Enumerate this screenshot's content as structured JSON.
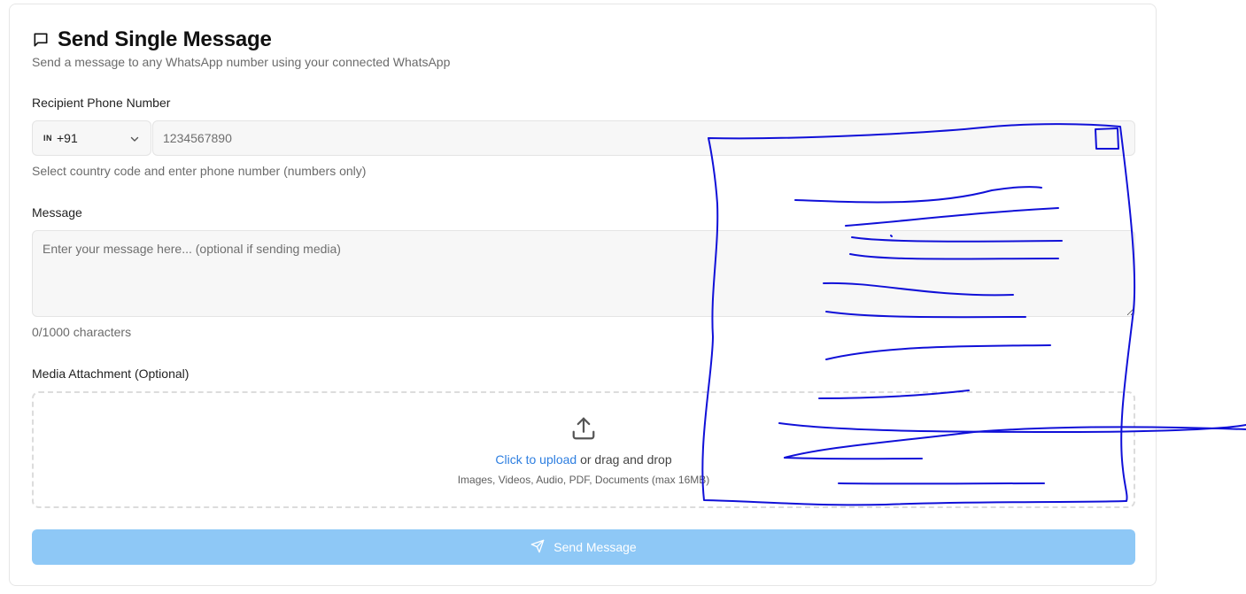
{
  "header": {
    "title": "Send Single Message",
    "subtitle": "Send a message to any WhatsApp number using your connected WhatsApp",
    "icon": "message-square-icon"
  },
  "phone": {
    "label": "Recipient Phone Number",
    "country_flag": "IN",
    "country_code": "+91",
    "placeholder": "1234567890",
    "hint": "Select country code and enter phone number (numbers only)"
  },
  "message": {
    "label": "Message",
    "placeholder": "Enter your message here... (optional if sending media)",
    "counter": "0/1000 characters"
  },
  "media": {
    "label": "Media Attachment (Optional)",
    "upload_link": "Click to upload",
    "upload_rest": " or drag and drop",
    "supported": "Images, Videos, Audio, PDF, Documents (max 16MB)",
    "icon": "upload-icon"
  },
  "send_button": {
    "label": "Send Message",
    "icon": "send-icon",
    "color": "#8ec8f6"
  },
  "colors": {
    "link": "#2d7ee0",
    "annotation": "#1010d8"
  }
}
